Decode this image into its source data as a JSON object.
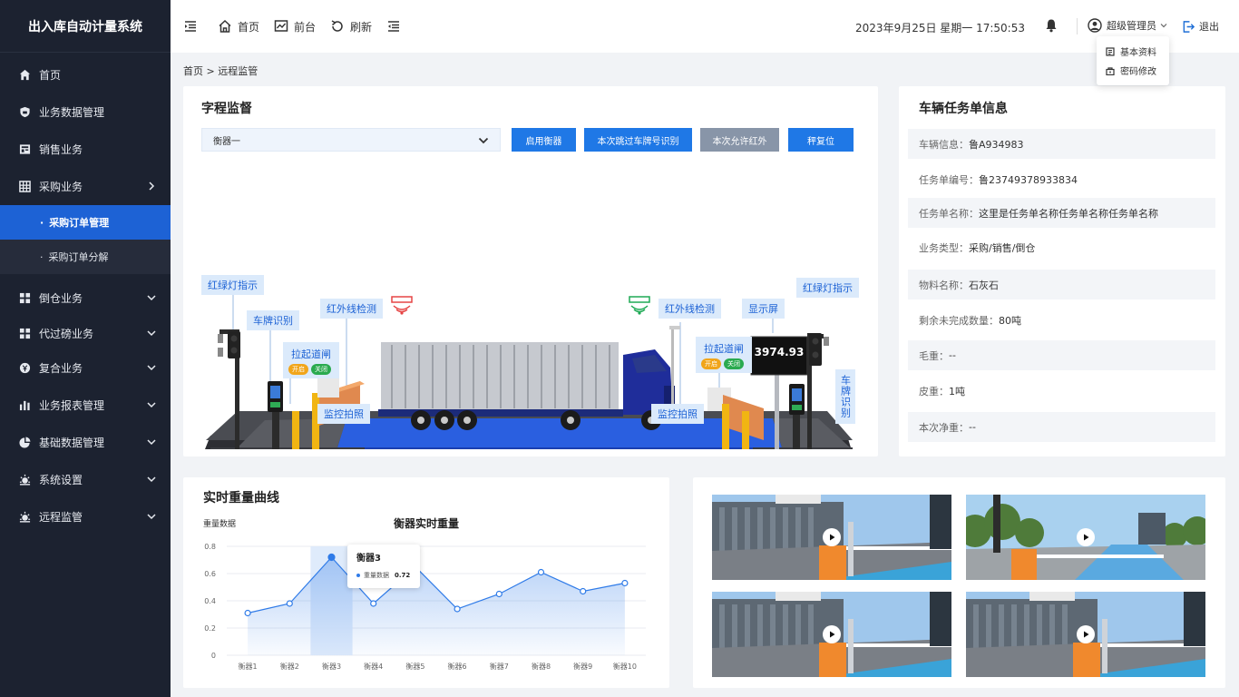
{
  "app": {
    "title": "出入库自动计量系统"
  },
  "sidebar": {
    "items": [
      {
        "label": "首页",
        "icon": "home-icon"
      },
      {
        "label": "业务数据管理",
        "icon": "shield-icon"
      },
      {
        "label": "销售业务",
        "icon": "store-icon"
      },
      {
        "label": "采购业务",
        "icon": "grid-icon",
        "expanded": true,
        "children": [
          {
            "label": "采购订单管理",
            "active": true
          },
          {
            "label": "采购订单分解"
          }
        ]
      },
      {
        "label": "倒仓业务",
        "icon": "apps-icon"
      },
      {
        "label": "代过磅业务",
        "icon": "apps-icon"
      },
      {
        "label": "复合业务",
        "icon": "coin-icon"
      },
      {
        "label": "业务报表管理",
        "icon": "bar-chart-icon"
      },
      {
        "label": "基础数据管理",
        "icon": "pie-chart-icon"
      },
      {
        "label": "系统设置",
        "icon": "gear-icon"
      },
      {
        "label": "远程监管",
        "icon": "monitor-icon"
      }
    ]
  },
  "topbar": {
    "home": "首页",
    "front": "前台",
    "refresh": "刷新",
    "datetime": "2023年9月25日 星期一 17:50:53",
    "user": "超级管理员",
    "logout": "退出",
    "user_menu": [
      "基本资料",
      "密码修改"
    ]
  },
  "breadcrumb": "首页 > 远程监管",
  "supervision": {
    "title": "字程监督",
    "select_value": "衡器一",
    "buttons": [
      "启用衡器",
      "本次跳过车牌号识别",
      "本次允许红外",
      "秤复位"
    ],
    "labels": {
      "traffic_left": "红绿灯指示",
      "plate_left": "车牌识别",
      "ir_left": "红外线检测",
      "gate_left": "拉起道闸",
      "cam_left": "监控拍照",
      "ir_right": "红外线检测",
      "display": "显示屏",
      "traffic_right": "红绿灯指示",
      "gate_right": "拉起道闸",
      "plate_right": "车牌识别",
      "cam_right": "监控拍照"
    },
    "open": "开启",
    "close": "关闭",
    "display_value": "3974.93",
    "colors": {
      "accent": "#1f78e6",
      "tag_bg": "#dbeafb",
      "ir_left": "#e64545",
      "ir_right": "#1faa55"
    }
  },
  "vehicle": {
    "title": "车辆任务单信息",
    "rows": [
      {
        "label": "车辆信息：",
        "value": "鲁A934983"
      },
      {
        "label": "任务单编号：",
        "value": "鲁23749378933834"
      },
      {
        "label": "任务单名称：",
        "value": "这里是任务单名称任务单名称任务单名称"
      },
      {
        "label": "业务类型：",
        "value": "采购/销售/倒仓"
      },
      {
        "label": "物料名称：",
        "value": "石灰石"
      },
      {
        "label": "剩余未完成数量：",
        "value": "80吨"
      },
      {
        "label": "毛重：",
        "value": "--"
      },
      {
        "label": "皮重：",
        "value": "1吨"
      },
      {
        "label": "本次净重：",
        "value": "--"
      }
    ]
  },
  "curve": {
    "card_title": "实时重量曲线",
    "tooltip": {
      "title": "衡器3",
      "label": "重量数据",
      "value": "0.72"
    }
  },
  "chart_data": {
    "type": "area",
    "title": "衡器实时重量",
    "ylabel": "重量数据",
    "categories": [
      "衡器1",
      "衡器2",
      "衡器3",
      "衡器4",
      "衡器5",
      "衡器6",
      "衡器7",
      "衡器8",
      "衡器9",
      "衡器10"
    ],
    "values": [
      0.31,
      0.38,
      0.72,
      0.38,
      0.65,
      0.34,
      0.45,
      0.61,
      0.47,
      0.53
    ],
    "ylim": [
      0,
      0.8
    ],
    "yticks": [
      "0",
      "0.2",
      "0.4",
      "0.6",
      "0.8"
    ],
    "highlight_index": 2,
    "grid": true,
    "color": "#2f7be8"
  }
}
